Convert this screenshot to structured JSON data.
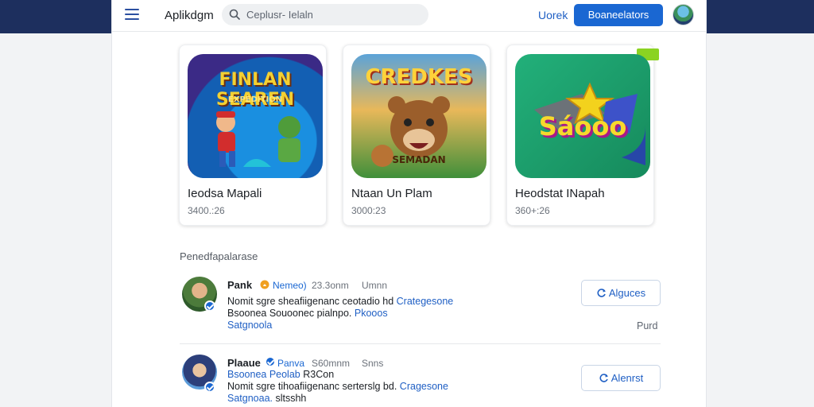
{
  "header": {
    "brand": "Aplikdgm",
    "search_placeholder": "Ceplusr- Ielaln",
    "link_label": "Uorek",
    "primary_button": "Boaneelators"
  },
  "cards": [
    {
      "art_title": "FINLAN SEAREN",
      "art_subtitle": "EXPEDITION",
      "name": "Ieodsa Mapali",
      "meta": "3400.:26",
      "art_colors": [
        "#1a8fe0",
        "#3b2a86",
        "#e5c028"
      ]
    },
    {
      "art_title": "CREDKES",
      "art_subtitle": "SEMADAN",
      "name": "Ntaan Un Plam",
      "meta": "3000:23",
      "art_colors": [
        "#e59a2c",
        "#6b3d1c",
        "#3f8f3a"
      ]
    },
    {
      "art_title": "Sáooo",
      "art_subtitle": "",
      "name": "Heodstat INapah",
      "meta": "360+:26",
      "art_colors": [
        "#1f9a6c",
        "#f3d21d",
        "#c42fa0"
      ]
    }
  ],
  "feed": {
    "section_title": "Penedfapalarase",
    "items": [
      {
        "name": "Pank",
        "tag": "Nemeo)",
        "time1": "23.3onm",
        "time2": "Umnn",
        "line1_text": "Nomit sgre sheafiigenanc ceotadio hd",
        "line1_link": "Crategesone",
        "line2_text": "Bsoonea Souoonec pialnpo.",
        "line2_link": "Pkooos",
        "line3_link": "Satgnoola",
        "button": "Alguces",
        "side_text": "Purd"
      },
      {
        "name": "Plaaue",
        "tag": "Panva",
        "time1": "S60mnm",
        "time2": "Snns",
        "line1_text": "Nomit sgre tihoafiigenanc serterslg bd.",
        "line1_link": "Cragesone",
        "line2_text": "Bsoonea Peolab",
        "line2_link": "",
        "line2_extra": "R3Con",
        "line3_link": "Satgnoaa.",
        "line3_extra": "sltsshh",
        "button": "Alenrst"
      }
    ]
  },
  "colors": {
    "accent": "#1a67d2",
    "topband": "#1d2f5e",
    "new_badge": "#8bd322"
  }
}
